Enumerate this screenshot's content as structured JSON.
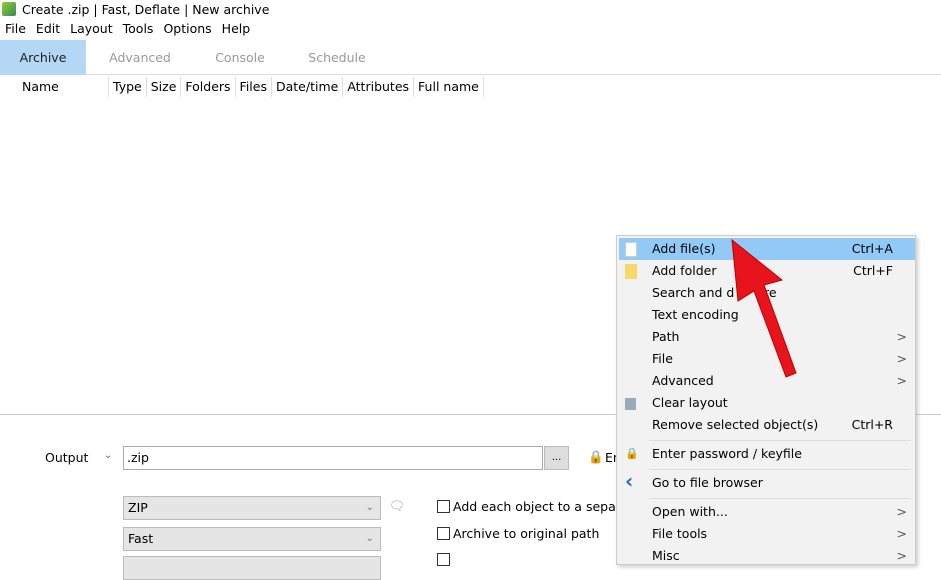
{
  "title": "Create .zip | Fast, Deflate | New archive",
  "menubar": [
    "File",
    "Edit",
    "Layout",
    "Tools",
    "Options",
    "Help"
  ],
  "tabs": [
    {
      "label": "Archive",
      "active": true
    },
    {
      "label": "Advanced"
    },
    {
      "label": "Console"
    },
    {
      "label": "Schedule"
    }
  ],
  "columns": [
    "Name",
    "Type",
    "Size",
    "Folders",
    "Files",
    "Date/time",
    "Attributes",
    "Full name"
  ],
  "output": {
    "label": "Output",
    "value": ".zip",
    "browse": "...",
    "encrypt_partial": "En"
  },
  "format": "ZIP",
  "level": "Fast",
  "options": [
    "Add each object to a separa",
    "Archive to original path"
  ],
  "context_menu": {
    "items": [
      {
        "label": "Add file(s)",
        "shortcut": "Ctrl+A",
        "icon": "file-icon",
        "highlighted": true
      },
      {
        "label": "Add folder",
        "shortcut": "Ctrl+F",
        "icon": "folder-icon"
      },
      {
        "label": "Search and d",
        "label_end": "re"
      },
      {
        "label": "Text encoding"
      },
      {
        "label": "Path",
        "submenu": ">"
      },
      {
        "label": "File",
        "submenu": ">"
      },
      {
        "label": "Advanced",
        "submenu": ">"
      },
      {
        "label": "Clear layout",
        "icon": "recycle-bin-icon"
      },
      {
        "label": "Remove selected object(s)",
        "shortcut": "Ctrl+R"
      },
      {
        "label": "Enter password / keyfile",
        "icon": "lock-icon"
      },
      {
        "label": "Go to file browser",
        "icon": "back-arrow-icon"
      },
      {
        "label": "Open with...",
        "submenu": ">"
      },
      {
        "label": "File tools",
        "submenu": ">"
      },
      {
        "label": "Misc",
        "submenu": ">"
      }
    ]
  },
  "colors": {
    "tab_active": "#b3d7f5",
    "menu_highlight": "#91c9f7",
    "annotation_arrow": "#e8141b"
  }
}
